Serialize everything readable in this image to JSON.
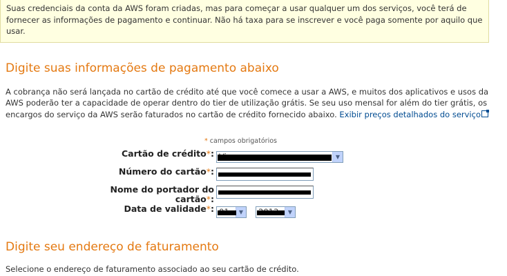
{
  "notice": {
    "text": "Suas credenciais da conta da AWS foram criadas, mas para começar a usar qualquer um dos serviços, você terá de fornecer as informações de pagamento e continuar. Não há taxa para se inscrever e você paga somente por aquilo que usar."
  },
  "payment": {
    "title": "Digite suas informações de pagamento abaixo",
    "description": "A cobrança não será lançada no cartão de crédito até que você comece a usar a AWS, e muitos dos aplicativos e usos da AWS poderão ter a capacidade de operar dentro do tier de utilização grátis. Se seu uso mensal for além do tier grátis, os encargos do serviço da AWS serão faturados no cartão de crédito fornecido abaixo. ",
    "pricing_link": "Exibir preços detalhados do serviço",
    "required_star": "*",
    "required_note": "campos obrigatórios",
    "fields": {
      "card_type_label": "Cartão de crédito",
      "card_type_value": "Visa",
      "card_number_label": "Número do cartão",
      "cardholder_label": "Nome do portador do cartão",
      "expiry_label": "Data de validade",
      "expiry_month": "01",
      "expiry_year": "2013",
      "colon": ":"
    }
  },
  "billing": {
    "title": "Digite seu endereço de faturamento",
    "description": "Selecione o endereço de faturamento associado ao seu cartão de crédito."
  },
  "colors": {
    "heading": "#e47911",
    "link": "#004b91",
    "notice_bg": "#ffffe1"
  }
}
